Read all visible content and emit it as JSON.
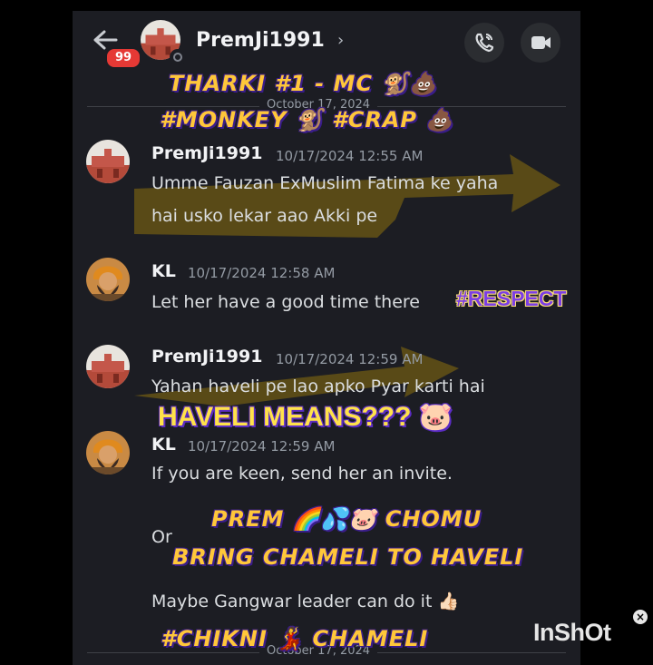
{
  "header": {
    "badge_count": "99",
    "title": "PremJi1991",
    "chevron": "›",
    "icons": [
      "back-arrow-icon",
      "phone-icon",
      "video-icon"
    ]
  },
  "date_separators": [
    "October 17, 2024",
    "October 17, 2024"
  ],
  "messages": [
    {
      "author": "PremJi1991",
      "time": "10/17/2024 12:55 AM",
      "lines": [
        "Umme Fauzan ExMuslim Fatima ke yaha",
        "hai usko lekar aao Akki pe"
      ]
    },
    {
      "author": "KL",
      "time": "10/17/2024 12:58 AM",
      "lines": [
        "Let her have a good time there"
      ]
    },
    {
      "author": "PremJi1991",
      "time": "10/17/2024 12:59 AM",
      "lines": [
        "Yahan haveli pe lao apko Pyar karti hai"
      ]
    },
    {
      "author": "KL",
      "time": "10/17/2024 12:59 AM",
      "lines": [
        "If you are keen, send her an invite."
      ]
    },
    {
      "author": "",
      "time": "",
      "lines": [
        "Or"
      ]
    },
    {
      "author": "",
      "time": "",
      "lines": [
        "Maybe Gangwar leader can do it 👍🏻"
      ]
    }
  ],
  "overlays": {
    "tharki": "THARKI #1 - MC 🐒💩",
    "monkey_crap": "#MONKEY 🐒 #CRAP 💩",
    "respect": "#RESPECT",
    "haveli_means": "HAVELI MEANS??? 🐷",
    "prem_chomu": "PREM 🌈💦🐷  CHOMU",
    "bring_chameli": "BRING CHAMELI TO HAVELI",
    "chikni_chameli": "#CHIKNI 💃 CHAMELI"
  },
  "watermark": "InShOt"
}
